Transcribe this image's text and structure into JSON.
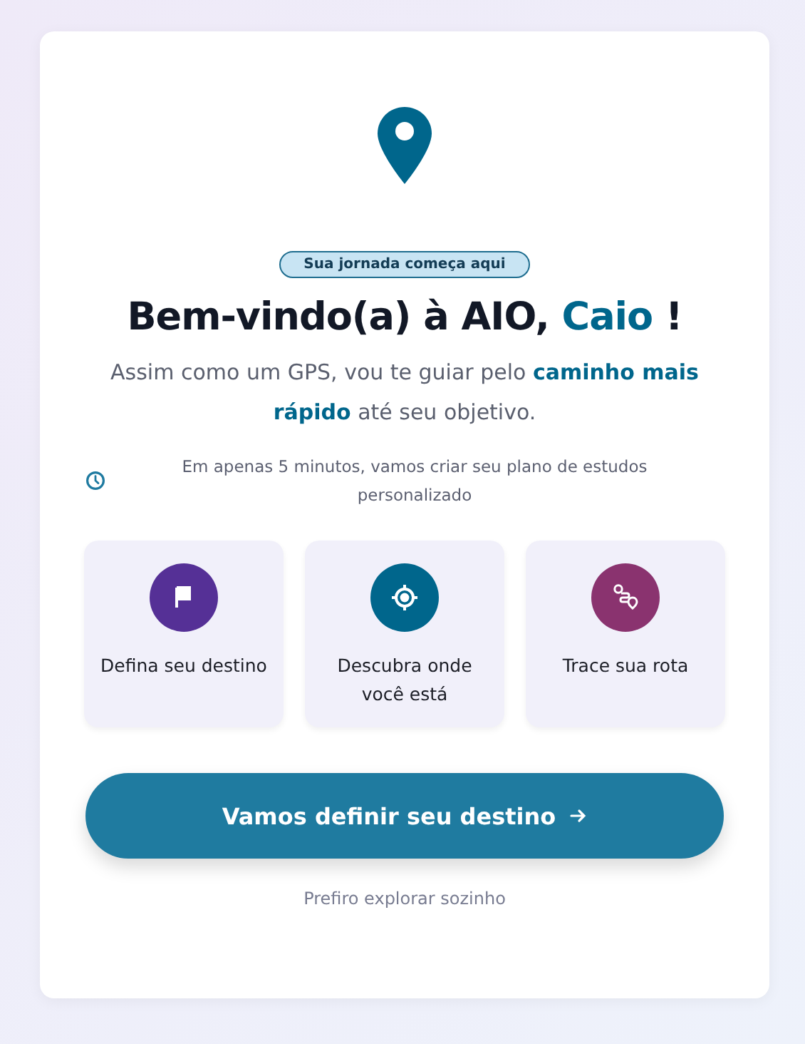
{
  "badge": "Sua jornada começa aqui",
  "title": "Bem-vindo(a) à AIO, **Caio** !",
  "subtitle": "Assim como um GPS, vou te guiar pelo **caminho mais rápido** até seu objetivo.",
  "note": "Em apenas 5 minutos, vamos criar seu plano de estudos personalizado",
  "steps": [
    {
      "kind": "flag",
      "color": "#553096",
      "label": "Defina seu destino"
    },
    {
      "kind": "target",
      "color": "#00668c",
      "label": "Descubra onde você está"
    },
    {
      "kind": "route",
      "color": "#8a336f",
      "label": "Trace sua rota"
    }
  ],
  "primary_button": "Vamos definir seu destino",
  "secondary_link": "Prefiro explorar sozinho"
}
